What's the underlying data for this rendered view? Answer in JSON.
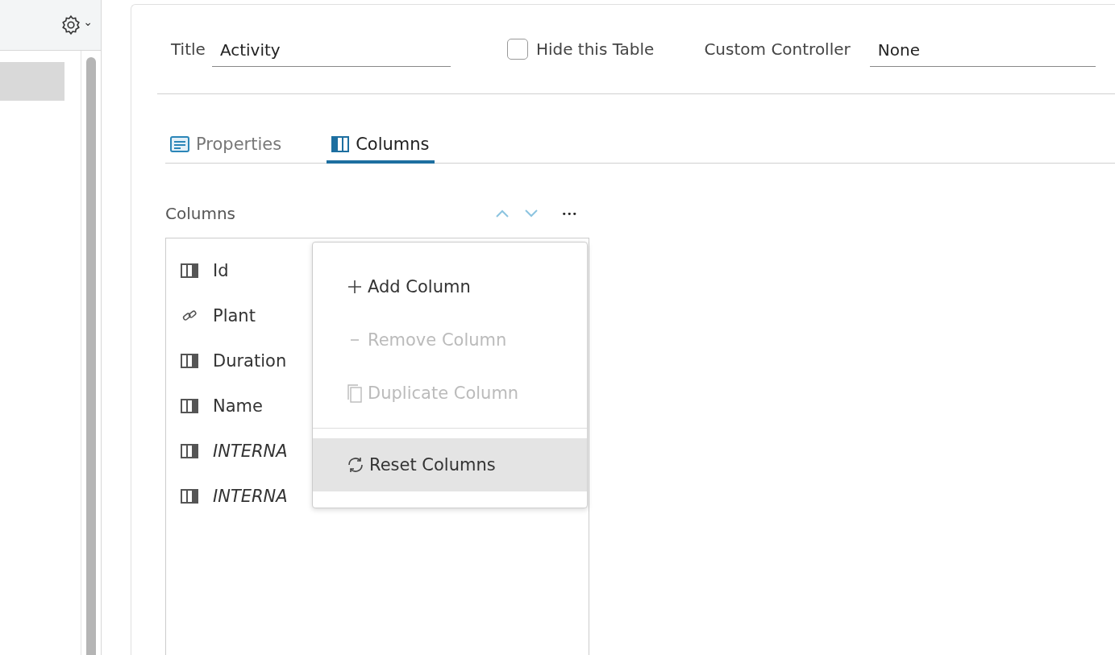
{
  "sidebar": {
    "settings_caret": "⌄",
    "items": [
      {
        "selected": true
      }
    ]
  },
  "form": {
    "title_label": "Title",
    "title_value": "Activity",
    "hide_table": {
      "label": "Hide this Table",
      "checked": false
    },
    "controller_label": "Custom Controller",
    "controller_value": "None"
  },
  "tabs": [
    {
      "label": "Properties",
      "selected": false,
      "kind": "properties"
    },
    {
      "label": "Columns",
      "selected": true,
      "kind": "columns"
    }
  ],
  "columns_panel": {
    "heading": "Columns",
    "more": "•••",
    "items": [
      {
        "label": "Id",
        "kind": "column",
        "italic": false
      },
      {
        "label": "Plant",
        "kind": "link",
        "italic": false
      },
      {
        "label": "Duration",
        "kind": "column",
        "italic": false
      },
      {
        "label": "Name",
        "kind": "column",
        "italic": false
      },
      {
        "label": "INTERNA",
        "kind": "column",
        "italic": true
      },
      {
        "label": "INTERNA",
        "kind": "column",
        "italic": true
      }
    ]
  },
  "menu": {
    "items": [
      {
        "label": "Add Column",
        "kind": "add",
        "disabled": false,
        "selected": false
      },
      {
        "label": "Remove Column",
        "kind": "remove",
        "disabled": true,
        "selected": false
      },
      {
        "label": "Duplicate Column",
        "kind": "duplicate",
        "disabled": true,
        "selected": false
      },
      {
        "label": "Reset Columns",
        "kind": "reset",
        "disabled": false,
        "selected": true
      }
    ]
  }
}
